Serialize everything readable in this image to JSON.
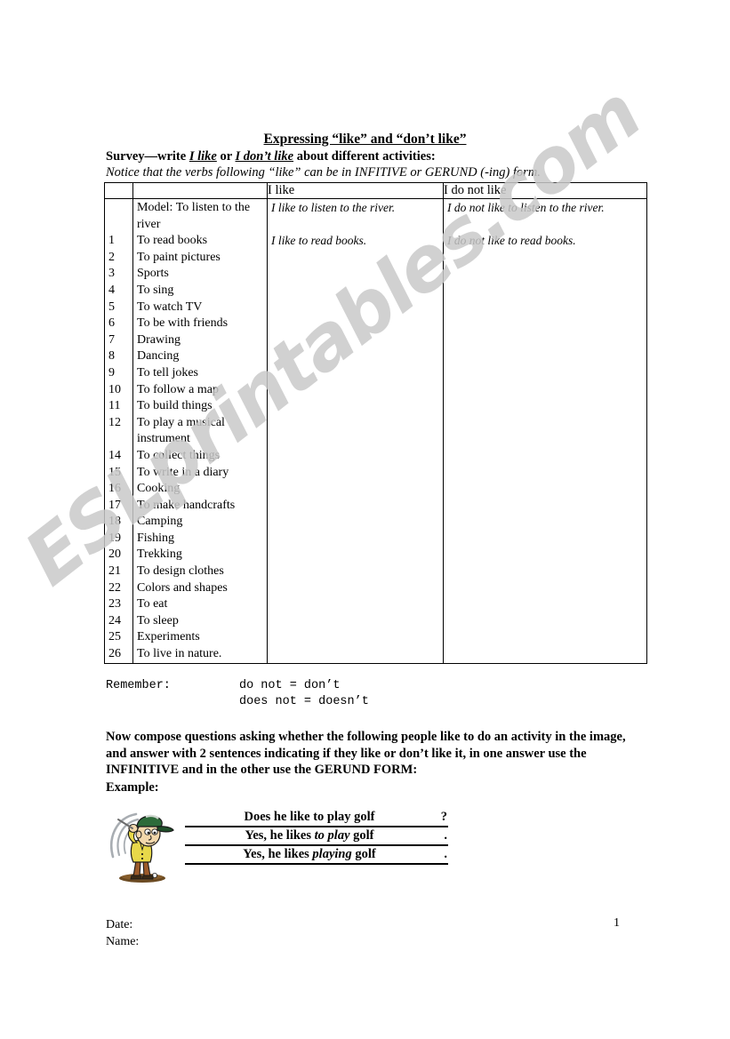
{
  "document": {
    "title_prefix": "Expressing ",
    "title": "Expressing “like” and “don’t like”",
    "survey_prefix": "Survey—write ",
    "survey_term_1": "I like",
    "survey_conj": " or ",
    "survey_term_2": "I don’t like",
    "survey_suffix": " about different activities:",
    "notice": "Notice that the verbs following “like” can be in INFITIVE or GERUND (-ing) form."
  },
  "table": {
    "headers": {
      "num": "",
      "activity": "",
      "like": "I like",
      "do_not_like": "I do not like"
    },
    "model_row": {
      "num": "",
      "activity": "Model: To listen to the river",
      "like": "I like to listen to the river.",
      "do_not_like": "I do not like to listen to the river."
    },
    "rows": [
      {
        "num": "1",
        "activity": "To read books",
        "like": "I like to read books.",
        "do_not_like": "I do not like to read books."
      },
      {
        "num": "2",
        "activity": "To paint pictures",
        "like": "",
        "do_not_like": ""
      },
      {
        "num": "3",
        "activity": "Sports",
        "like": "",
        "do_not_like": ""
      },
      {
        "num": "4",
        "activity": "To sing",
        "like": "",
        "do_not_like": ""
      },
      {
        "num": "5",
        "activity": "To watch TV",
        "like": "",
        "do_not_like": ""
      },
      {
        "num": "6",
        "activity": "To be with friends",
        "like": "",
        "do_not_like": ""
      },
      {
        "num": "7",
        "activity": "Drawing",
        "like": "",
        "do_not_like": ""
      },
      {
        "num": "8",
        "activity": "Dancing",
        "like": "",
        "do_not_like": ""
      },
      {
        "num": "9",
        "activity": "To tell jokes",
        "like": "",
        "do_not_like": ""
      },
      {
        "num": "10",
        "activity": "To follow a map",
        "like": "",
        "do_not_like": ""
      },
      {
        "num": "11",
        "activity": "To build things",
        "like": "",
        "do_not_like": ""
      },
      {
        "num": "12",
        "activity": "To play a musical instrument",
        "like": "",
        "do_not_like": "",
        "two_lines": true
      },
      {
        "num": "14",
        "activity": "To collect things",
        "like": "",
        "do_not_like": ""
      },
      {
        "num": "15",
        "activity": "To write in a diary",
        "like": "",
        "do_not_like": ""
      },
      {
        "num": "16",
        "activity": "Cooking",
        "like": "",
        "do_not_like": ""
      },
      {
        "num": "17",
        "activity": "To make handcrafts",
        "like": "",
        "do_not_like": ""
      },
      {
        "num": "18",
        "activity": "Camping",
        "like": "",
        "do_not_like": ""
      },
      {
        "num": "19",
        "activity": "Fishing",
        "like": "",
        "do_not_like": ""
      },
      {
        "num": "20",
        "activity": "Trekking",
        "like": "",
        "do_not_like": ""
      },
      {
        "num": "21",
        "activity": "To design clothes",
        "like": "",
        "do_not_like": ""
      },
      {
        "num": "22",
        "activity": "Colors and shapes",
        "like": "",
        "do_not_like": ""
      },
      {
        "num": "23",
        "activity": "To eat",
        "like": "",
        "do_not_like": ""
      },
      {
        "num": "24",
        "activity": "To sleep",
        "like": "",
        "do_not_like": ""
      },
      {
        "num": "25",
        "activity": "Experiments",
        "like": "",
        "do_not_like": ""
      },
      {
        "num": "26",
        "activity": "To live in nature.",
        "like": "",
        "do_not_like": ""
      }
    ]
  },
  "remember": {
    "label": "Remember:",
    "line1": "do not = don’t",
    "line2": "does not = doesn’t"
  },
  "instructions": {
    "paragraph": "Now compose questions asking whether the following people like to do an activity in the image, and answer with 2 sentences indicating if they like or don’t like it, in one answer use the INFINITIVE and in the other use the GERUND FORM:",
    "example_label": "Example:"
  },
  "example": {
    "question": {
      "text": "Does he like to play golf",
      "mark": "?"
    },
    "answer_1": {
      "prefix": "Yes, he likes ",
      "emph": "to play",
      "suffix": " golf",
      "mark": "."
    },
    "answer_2": {
      "prefix": "Yes, he likes ",
      "emph": "playing",
      "suffix": " golf",
      "mark": "."
    },
    "clipart": {
      "name": "golfer-clipart",
      "cap_color": "#2d6b3a",
      "shirt_color": "#e8d84a",
      "pants_color": "#9c5b2a",
      "skin_color": "#f2d7ab",
      "outline_color": "#1a1a1a",
      "ground_color": "#6b4a22",
      "swing_arc_color": "#9aa0a6"
    }
  },
  "footer": {
    "date_label": "Date:",
    "name_label": "Name:",
    "page_number": "1"
  },
  "watermark": {
    "text": "ESLprintables.com",
    "color": "#c9c9c9"
  }
}
